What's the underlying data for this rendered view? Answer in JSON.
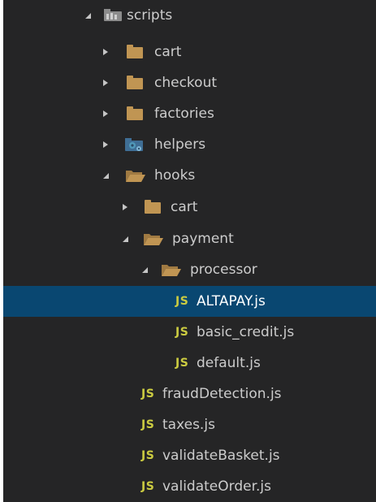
{
  "colors": {
    "background": "#252526",
    "selection": "#094771",
    "text": "#cccccc",
    "folder": "#c09553",
    "js_icon": "#cbcb41",
    "helpers_icon": "#519aba"
  },
  "tree": [
    {
      "label": "scripts",
      "type": "folder",
      "expanded": true,
      "icon": "scripts-folder-icon"
    },
    {
      "label": "cart",
      "type": "folder",
      "expanded": false,
      "icon": "folder-icon"
    },
    {
      "label": "checkout",
      "type": "folder",
      "expanded": false,
      "icon": "folder-icon"
    },
    {
      "label": "factories",
      "type": "folder",
      "expanded": false,
      "icon": "folder-icon"
    },
    {
      "label": "helpers",
      "type": "folder",
      "expanded": false,
      "icon": "helpers-folder-icon"
    },
    {
      "label": "hooks",
      "type": "folder",
      "expanded": true,
      "icon": "folder-open-icon"
    },
    {
      "label": "cart",
      "type": "folder",
      "expanded": false,
      "icon": "folder-icon"
    },
    {
      "label": "payment",
      "type": "folder",
      "expanded": true,
      "icon": "folder-open-icon"
    },
    {
      "label": "processor",
      "type": "folder",
      "expanded": true,
      "icon": "folder-open-icon"
    },
    {
      "label": "ALTAPAY.js",
      "type": "file",
      "icon": "js-file-icon",
      "icon_text": "JS",
      "selected": true
    },
    {
      "label": "basic_credit.js",
      "type": "file",
      "icon": "js-file-icon",
      "icon_text": "JS"
    },
    {
      "label": "default.js",
      "type": "file",
      "icon": "js-file-icon",
      "icon_text": "JS"
    },
    {
      "label": "fraudDetection.js",
      "type": "file",
      "icon": "js-file-icon",
      "icon_text": "JS"
    },
    {
      "label": "taxes.js",
      "type": "file",
      "icon": "js-file-icon",
      "icon_text": "JS"
    },
    {
      "label": "validateBasket.js",
      "type": "file",
      "icon": "js-file-icon",
      "icon_text": "JS"
    },
    {
      "label": "validateOrder.js",
      "type": "file",
      "icon": "js-file-icon",
      "icon_text": "JS"
    }
  ]
}
